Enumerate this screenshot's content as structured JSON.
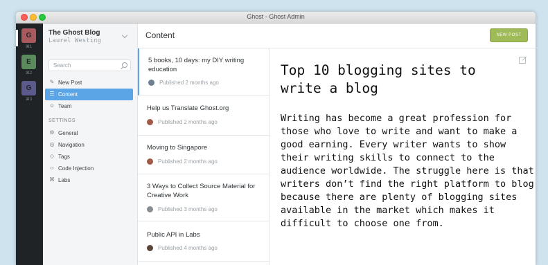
{
  "window": {
    "title": "Ghost - Ghost Admin"
  },
  "switcher": [
    {
      "letter": "G",
      "shortcut": "⌘1",
      "color": "#a85a5e"
    },
    {
      "letter": "E",
      "shortcut": "⌘2",
      "color": "#5b8a5d"
    },
    {
      "letter": "G",
      "shortcut": "⌘3",
      "color": "#5a5b8c"
    }
  ],
  "sidebar": {
    "blog_title": "The Ghost Blog",
    "user": "Laurel Westing",
    "search_placeholder": "Search",
    "nav": [
      {
        "label": "New Post",
        "icon": "pencil-icon"
      },
      {
        "label": "Content",
        "icon": "content-icon"
      },
      {
        "label": "Team",
        "icon": "team-icon"
      }
    ],
    "settings_heading": "SETTINGS",
    "settings": [
      {
        "label": "General",
        "icon": "gear-icon"
      },
      {
        "label": "Navigation",
        "icon": "compass-icon"
      },
      {
        "label": "Tags",
        "icon": "tag-icon"
      },
      {
        "label": "Code Injection",
        "icon": "code-icon"
      },
      {
        "label": "Labs",
        "icon": "labs-icon"
      }
    ]
  },
  "content": {
    "title": "Content",
    "new_post_label": "NEW POST",
    "posts": [
      {
        "title": "5 books, 10 days: my DIY writing education",
        "meta": "Published 2 months ago",
        "avatar_color": "#6e7f91"
      },
      {
        "title": "Help us Translate Ghost.org",
        "meta": "Published 2 months ago",
        "avatar_color": "#a05a48"
      },
      {
        "title": "Moving to Singapore",
        "meta": "Published 2 months ago",
        "avatar_color": "#a05a48"
      },
      {
        "title": "3 Ways to Collect Source Material for Creative Work",
        "meta": "Published 3 months ago",
        "avatar_color": "#8a8f94"
      },
      {
        "title": "Public API in Labs",
        "meta": "Published 4 months ago",
        "avatar_color": "#5a4538"
      }
    ]
  },
  "preview": {
    "title": "Top 10 blogging sites to write a blog",
    "body": "Writing has become a great profession for those who love to write and want to make a good earning. Every writer wants to show their writing skills to connect to the audience worldwide. The struggle here is that writers don’t find the right platform to blog because there are plenty of blogging sites available in the market which makes it difficult to choose one from."
  }
}
